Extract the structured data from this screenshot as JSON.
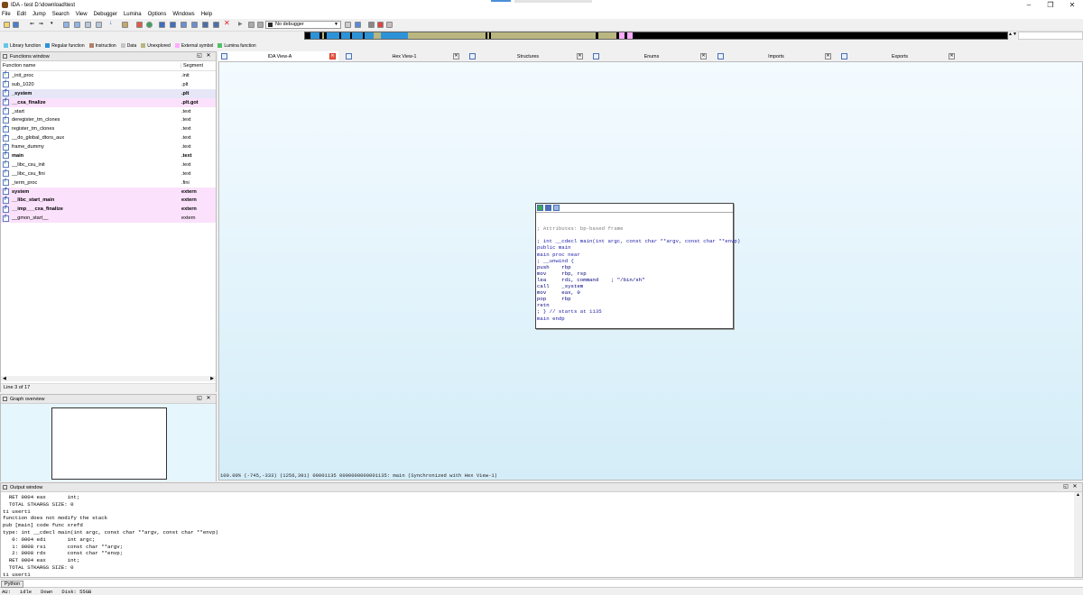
{
  "window": {
    "title": "IDA - test D:\\download\\test",
    "controls": [
      "–",
      "❐",
      "✕"
    ]
  },
  "menu": [
    "File",
    "Edit",
    "Jump",
    "Search",
    "View",
    "Debugger",
    "Lumina",
    "Options",
    "Windows",
    "Help"
  ],
  "toolbar": {
    "debugger_select": "No debugger"
  },
  "legend": [
    {
      "label": "Library function",
      "color": "#67c5e8"
    },
    {
      "label": "Regular function",
      "color": "#2c93d9"
    },
    {
      "label": "Instruction",
      "color": "#b0826a"
    },
    {
      "label": "Data",
      "color": "#c5c5c5"
    },
    {
      "label": "Unexplored",
      "color": "#b9b67f"
    },
    {
      "label": "External symbol",
      "color": "#ffaaff"
    },
    {
      "label": "Lumina function",
      "color": "#53c067"
    }
  ],
  "functions_window": {
    "title": "Functions window",
    "col_name": "Function name",
    "col_segment": "Segment",
    "rows": [
      {
        "name": "_init_proc",
        "segment": ".init",
        "style": ""
      },
      {
        "name": "sub_1020",
        "segment": ".plt",
        "style": ""
      },
      {
        "name": "_system",
        "segment": ".plt",
        "style": "selected bold"
      },
      {
        "name": "__cxa_finalize",
        "segment": ".plt.got",
        "style": "import bold"
      },
      {
        "name": "_start",
        "segment": ".text",
        "style": ""
      },
      {
        "name": "deregister_tm_clones",
        "segment": ".text",
        "style": ""
      },
      {
        "name": "register_tm_clones",
        "segment": ".text",
        "style": ""
      },
      {
        "name": "__do_global_dtors_aux",
        "segment": ".text",
        "style": ""
      },
      {
        "name": "frame_dummy",
        "segment": ".text",
        "style": ""
      },
      {
        "name": "main",
        "segment": ".text",
        "style": "bold"
      },
      {
        "name": "__libc_csu_init",
        "segment": ".text",
        "style": ""
      },
      {
        "name": "__libc_csu_fini",
        "segment": ".text",
        "style": ""
      },
      {
        "name": "_term_proc",
        "segment": ".fini",
        "style": ""
      },
      {
        "name": "system",
        "segment": "extern",
        "style": "import bold"
      },
      {
        "name": "__libc_start_main",
        "segment": "extern",
        "style": "import bold"
      },
      {
        "name": "__imp___cxa_finalize",
        "segment": "extern",
        "style": "import bold"
      },
      {
        "name": "__gmon_start__",
        "segment": "extern",
        "style": "import"
      }
    ],
    "status": "Line 3 of 17"
  },
  "graph_overview": {
    "title": "Graph overview"
  },
  "tabs": [
    "IDA View-A",
    "Hex View-1",
    "Structures",
    "Enums",
    "Imports",
    "Exports"
  ],
  "ida_view": {
    "code": [
      {
        "text": "",
        "cls": ""
      },
      {
        "text": "",
        "cls": ""
      },
      {
        "text": "; Attributes: bp-based frame",
        "cls": "c-comment"
      },
      {
        "text": "",
        "cls": ""
      },
      {
        "text": "; int __cdecl main(int argc, const char **argv, const char **envp)",
        "cls": "c-blue"
      },
      {
        "text": "public main",
        "cls": "c-blue"
      },
      {
        "text": "main proc near",
        "cls": "c-blue"
      },
      {
        "text": "; __unwind {",
        "cls": "c-blue"
      },
      {
        "text": "push    rbp",
        "cls": "c-kw"
      },
      {
        "text": "mov     rbp, rsp",
        "cls": "c-kw"
      },
      {
        "text": "lea     rdi, command    ; \"/bin/sh\"",
        "cls": "c-kw"
      },
      {
        "text": "call    _system",
        "cls": "c-kw"
      },
      {
        "text": "mov     eax, 0",
        "cls": "c-kw"
      },
      {
        "text": "pop     rbp",
        "cls": "c-kw"
      },
      {
        "text": "retn",
        "cls": "c-kw"
      },
      {
        "text": "; } // starts at 1135",
        "cls": "c-blue"
      },
      {
        "text": "main endp",
        "cls": "c-blue"
      }
    ],
    "status": "100.00% (-745,-333) (1256,391) 00001135 0000000000001135: main (Synchronized with Hex View-1)"
  },
  "output_window": {
    "title": "Output window",
    "lines": [
      "  RET 0004 eax       int;",
      "  TOTAL STKARGS SIZE: 0",
      "ti usert1",
      "function does not modify the stack",
      "pub [main] code func xrefd",
      "type: int __cdecl main(int argc, const char **argv, const char **envp)",
      "   0: 0004 edi       int argc;",
      "   1: 0008 rsi       const char **argv;",
      "   2: 0008 rdx       const char **envp;",
      "  RET 0004 eax       int;",
      "  TOTAL STKARGS SIZE: 0",
      "ti usert1",
      "function does not modify the stack"
    ]
  },
  "python_button": "Python",
  "statusbar": [
    "AU:",
    "idle",
    "Down",
    "Disk: 55GB"
  ]
}
